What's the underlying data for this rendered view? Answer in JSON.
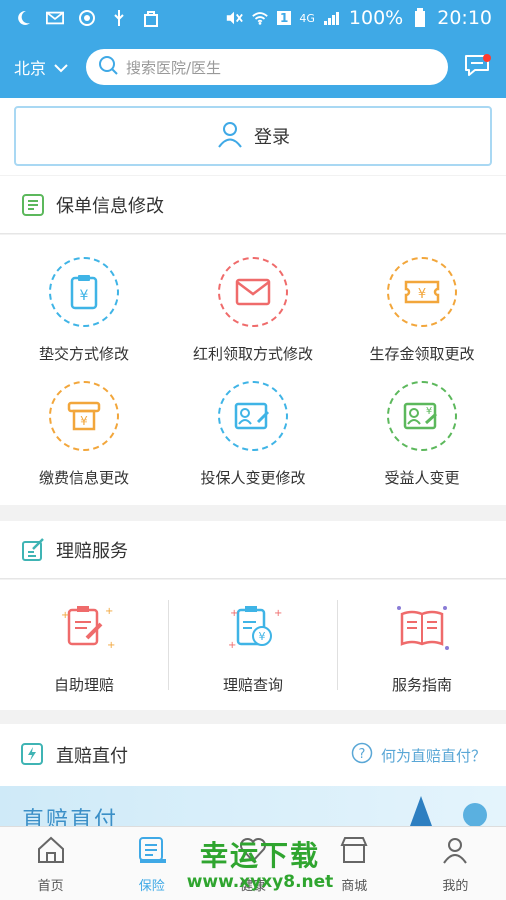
{
  "status_bar": {
    "battery": "100%",
    "time": "20:10",
    "network": "4G",
    "sim": "1"
  },
  "header": {
    "city": "北京",
    "search_placeholder": "搜索医院/医生"
  },
  "login": {
    "label": "登录"
  },
  "policy_section": {
    "title": "保单信息修改",
    "items": [
      {
        "label": "垫交方式修改",
        "color": "#3fb4e6"
      },
      {
        "label": "红利领取方式修改",
        "color": "#ef6b6b"
      },
      {
        "label": "生存金领取更改",
        "color": "#f2a63b"
      },
      {
        "label": "缴费信息更改",
        "color": "#f2a63b"
      },
      {
        "label": "投保人变更修改",
        "color": "#3fb4e6"
      },
      {
        "label": "受益人变更",
        "color": "#5cb85c"
      }
    ]
  },
  "claims_section": {
    "title": "理赔服务",
    "items": [
      {
        "label": "自助理赔"
      },
      {
        "label": "理赔查询"
      },
      {
        "label": "服务指南"
      }
    ]
  },
  "direct_pay": {
    "title": "直赔直付",
    "help": "何为直赔直付？",
    "banner_text": "直赔直付"
  },
  "tabbar": {
    "tabs": [
      {
        "label": "首页"
      },
      {
        "label": "保险"
      },
      {
        "label": "健康"
      },
      {
        "label": "商城"
      },
      {
        "label": "我的"
      }
    ]
  },
  "watermark": {
    "line1": "幸运下载",
    "line2": "www.xyxy8.net"
  },
  "colors": {
    "primary": "#3fa9e6",
    "accent_red": "#ef6b6b",
    "accent_orange": "#f2a63b",
    "accent_green": "#5cb85c"
  }
}
